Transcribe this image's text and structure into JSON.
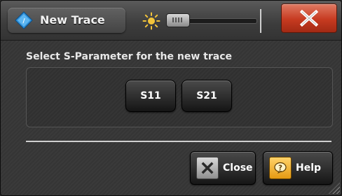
{
  "window": {
    "title": "New Trace"
  },
  "icons": {
    "app": "rohde-schwarz-diamond-icon",
    "brightness": "sun-icon",
    "close": "close-x-icon",
    "close_button": "close-x-box-icon",
    "help_button": "help-question-icon"
  },
  "colors": {
    "close_titlebar": "#c63a20",
    "help_icon": "#f0b030",
    "app_icon": "#3aa0e8"
  },
  "main": {
    "prompt": "Select S-Parameter for the new trace",
    "buttons": [
      {
        "label": "S11"
      },
      {
        "label": "S21"
      }
    ]
  },
  "footer": {
    "close_label": "Close",
    "help_label": "Help"
  }
}
